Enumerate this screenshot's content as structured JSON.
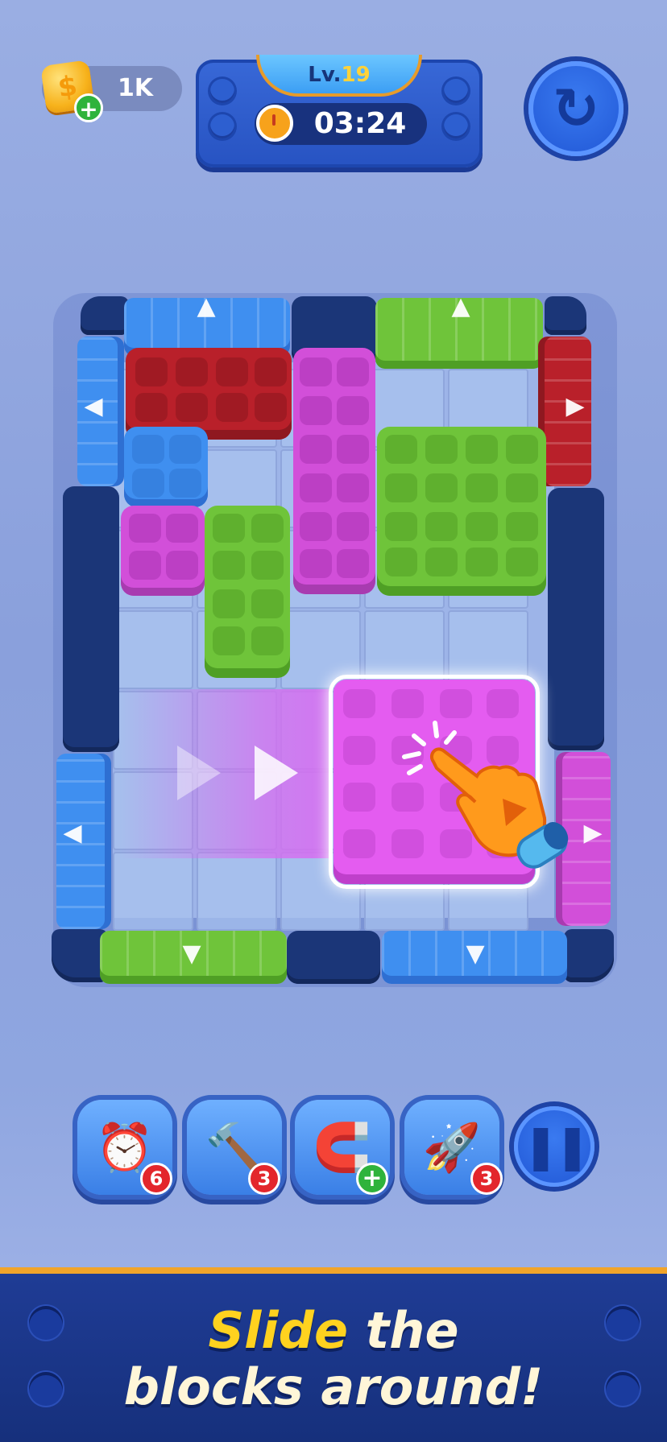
{
  "hud": {
    "coins": "1K",
    "coin_plus": "+",
    "level_prefix": "Lv.",
    "level_number": "19",
    "timer": "03:24",
    "restart_icon": "restart-icon"
  },
  "board": {
    "arrows": {
      "top_left": "▲",
      "top_right": "▲",
      "left_top": "◀",
      "left_bottom": "◀",
      "right_top": "▶",
      "right_bottom": "▶",
      "bottom_left": "▼",
      "bottom_right": "▼"
    },
    "colors": {
      "blue": "#3f8ff0",
      "green": "#6fc43a",
      "red": "#b9202a",
      "magenta": "#d24fd9",
      "pink_highlight": "#e45cf0"
    }
  },
  "boosters": [
    {
      "name": "freeze-clock",
      "icon": "⏰",
      "count": "6"
    },
    {
      "name": "hammer",
      "icon": "🔨",
      "count": "3"
    },
    {
      "name": "vacuum",
      "icon": "🧲",
      "count": "+"
    },
    {
      "name": "rocket",
      "icon": "🚀",
      "count": "3"
    }
  ],
  "pause_icon": "❚❚",
  "footer": {
    "highlight": "Slide",
    "line1_rest": " the",
    "line2": "blocks around!"
  }
}
